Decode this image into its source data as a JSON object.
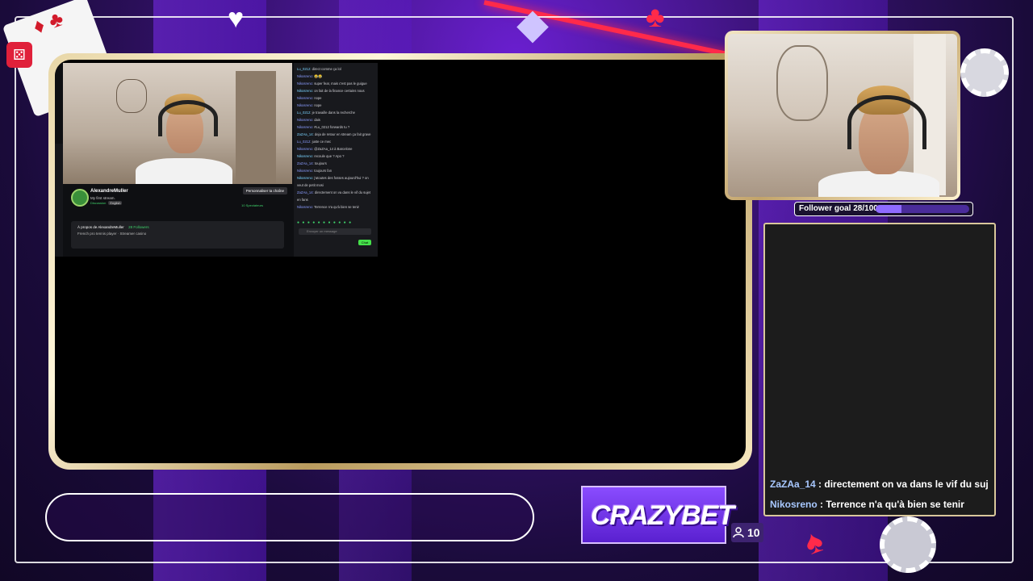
{
  "colors": {
    "accent": "#7b2cf0",
    "frame_gold": "#d9c79b",
    "chat_user": "#a8c8ff",
    "twitch_green": "#45e04a"
  },
  "embedded_stream": {
    "channel_name": "AlexandreMuller",
    "stream_title": "My first stream.",
    "category": "Discussion",
    "language_tag": "English",
    "customize_button": "Personnaliser ta chaîne",
    "viewers_label": "10 Spectateurs",
    "about_title": "À propos de AlexandreMuller",
    "followers": "28 Followers",
    "about_desc": "French pro tennis player · Streamer casino",
    "chat_messages": [
      {
        "user": "Lu_0212",
        "text": "direct comme ça lol"
      },
      {
        "user": "Nikosreno",
        "text": "😂😂"
      },
      {
        "user": "Nikosreno",
        "text": "super fear, mais c'est pas le guigue"
      },
      {
        "user": "Nikosreno",
        "text": "on fait de la finance certains nous"
      },
      {
        "user": "Nikosreno",
        "text": "nope"
      },
      {
        "user": "Nikosreno",
        "text": "nope"
      },
      {
        "user": "Lu_0212",
        "text": "je travaille dans la recherche"
      },
      {
        "user": "Nikosreno",
        "text": "dais"
      },
      {
        "user": "Nikosreno",
        "text": "#Lu_0212 forwards tu ?"
      },
      {
        "user": "ZaZAa_14",
        "text": "deja de retour en stream ça fait grave"
      },
      {
        "user": "Lu_0212",
        "text": "juste ce mec"
      },
      {
        "user": "Nikosreno",
        "text": "@ZaZAa_14 à Barcelone"
      },
      {
        "user": "Nikosreno",
        "text": "recoule que ? Apo ?"
      },
      {
        "user": "ZaZAa_14",
        "text": "toujours"
      },
      {
        "user": "Nikosreno",
        "text": "toujours fan"
      },
      {
        "user": "Nikosreno",
        "text": "j'atoutes des fosses aujourd'hui ? on veut de petit mosi"
      },
      {
        "user": "ZaZAa_14",
        "text": "directement on va dans le vif du sujet en fans"
      },
      {
        "user": "Nikosreno",
        "text": "Terrence n'a qu'à bien se tenir"
      }
    ],
    "chat_placeholder": "Envoyer un message",
    "chat_button": "Chat"
  },
  "follower_goal": {
    "label": "Follower goal 28/100",
    "current": 28,
    "target": 100
  },
  "chat_overlay": [
    {
      "user": "ZaZAa_14",
      "sep": " : ",
      "text": "directement on va dans le vif du suj"
    },
    {
      "user": "Nikosreno",
      "sep": " : ",
      "text": "Terrence n'a qu'à bien se tenir"
    }
  ],
  "sponsor": {
    "logo_text": "CRAZYBET"
  },
  "viewer_count": {
    "icon": "person-icon",
    "value": "10"
  }
}
